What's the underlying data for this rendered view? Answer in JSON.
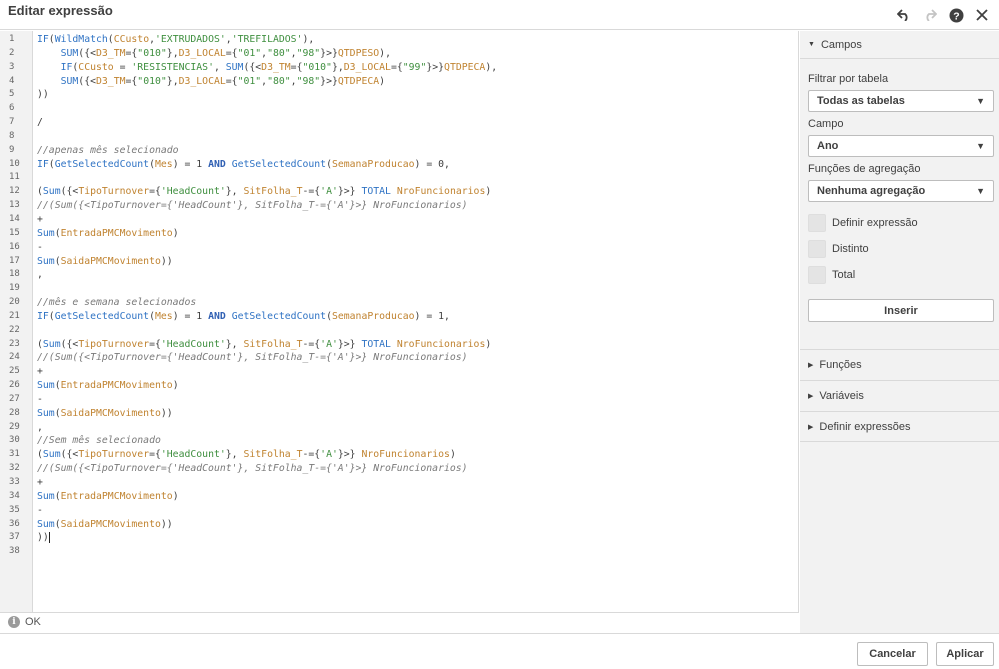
{
  "window": {
    "title": "Editar expressão",
    "icons": [
      "undo-icon",
      "redo-icon",
      "help-icon",
      "close-icon"
    ]
  },
  "editor": {
    "line_numbers": [
      "1",
      "2",
      "3",
      "4",
      "5",
      "6",
      "7",
      "8",
      "9",
      "10",
      "11",
      "12",
      "13",
      "14",
      "15",
      "16",
      "17",
      "18",
      "19",
      "20",
      "21",
      "22",
      "23",
      "24",
      "25",
      "26",
      "27",
      "28",
      "29",
      "30",
      "31",
      "32",
      "33",
      "34",
      "35",
      "36",
      "37",
      "38"
    ],
    "lines": [
      [
        [
          "fn",
          "IF"
        ],
        [
          "op",
          "("
        ],
        [
          "fn",
          "WildMatch"
        ],
        [
          "op",
          "("
        ],
        [
          "fld",
          "CCusto"
        ],
        [
          "op",
          ","
        ],
        [
          "str",
          "'EXTRUDADOS'"
        ],
        [
          "op",
          ","
        ],
        [
          "str",
          "'TREFILADOS'"
        ],
        [
          "op",
          "),"
        ]
      ],
      [
        [
          "op",
          "    "
        ],
        [
          "fn",
          "SUM"
        ],
        [
          "op",
          "({<"
        ],
        [
          "fld",
          "D3_TM"
        ],
        [
          "op",
          "={"
        ],
        [
          "str",
          "\"010\""
        ],
        [
          "op",
          "},"
        ],
        [
          "fld",
          "D3_LOCAL"
        ],
        [
          "op",
          "={"
        ],
        [
          "str",
          "\"01\""
        ],
        [
          "op",
          ","
        ],
        [
          "str",
          "\"80\""
        ],
        [
          "op",
          ","
        ],
        [
          "str",
          "\"98\""
        ],
        [
          "op",
          "}>}"
        ],
        [
          "fld",
          "QTDPESO"
        ],
        [
          "op",
          "),"
        ]
      ],
      [
        [
          "op",
          "    "
        ],
        [
          "fn",
          "IF"
        ],
        [
          "op",
          "("
        ],
        [
          "fld",
          "CCusto"
        ],
        [
          "op",
          " = "
        ],
        [
          "str",
          "'RESISTENCIAS'"
        ],
        [
          "op",
          ", "
        ],
        [
          "fn",
          "SUM"
        ],
        [
          "op",
          "({<"
        ],
        [
          "fld",
          "D3_TM"
        ],
        [
          "op",
          "={"
        ],
        [
          "str",
          "\"010\""
        ],
        [
          "op",
          "},"
        ],
        [
          "fld",
          "D3_LOCAL"
        ],
        [
          "op",
          "={"
        ],
        [
          "str",
          "\"99\""
        ],
        [
          "op",
          "}>}"
        ],
        [
          "fld",
          "QTDPECA"
        ],
        [
          "op",
          "),"
        ]
      ],
      [
        [
          "op",
          "    "
        ],
        [
          "fn",
          "SUM"
        ],
        [
          "op",
          "({<"
        ],
        [
          "fld",
          "D3_TM"
        ],
        [
          "op",
          "={"
        ],
        [
          "str",
          "\"010\""
        ],
        [
          "op",
          "},"
        ],
        [
          "fld",
          "D3_LOCAL"
        ],
        [
          "op",
          "={"
        ],
        [
          "str",
          "\"01\""
        ],
        [
          "op",
          ","
        ],
        [
          "str",
          "\"80\""
        ],
        [
          "op",
          ","
        ],
        [
          "str",
          "\"98\""
        ],
        [
          "op",
          "}>}"
        ],
        [
          "fld",
          "QTDPECA"
        ],
        [
          "op",
          ")"
        ]
      ],
      [
        [
          "op",
          "))"
        ]
      ],
      [],
      [
        [
          "op",
          "/"
        ]
      ],
      [],
      [
        [
          "com",
          "//apenas mês selecionado"
        ]
      ],
      [
        [
          "fn",
          "IF"
        ],
        [
          "op",
          "("
        ],
        [
          "fn",
          "GetSelectedCount"
        ],
        [
          "op",
          "("
        ],
        [
          "fld",
          "Mes"
        ],
        [
          "op",
          ") = 1 "
        ],
        [
          "kw",
          "AND"
        ],
        [
          "op",
          " "
        ],
        [
          "fn",
          "GetSelectedCount"
        ],
        [
          "op",
          "("
        ],
        [
          "fld",
          "SemanaProducao"
        ],
        [
          "op",
          ") = 0,"
        ]
      ],
      [],
      [
        [
          "op",
          "("
        ],
        [
          "fn",
          "Sum"
        ],
        [
          "op",
          "({<"
        ],
        [
          "fld",
          "TipoTurnover"
        ],
        [
          "op",
          "={"
        ],
        [
          "str",
          "'HeadCount'"
        ],
        [
          "op",
          "}, "
        ],
        [
          "fld",
          "SitFolha_T"
        ],
        [
          "op",
          "-={"
        ],
        [
          "str",
          "'A'"
        ],
        [
          "op",
          "}>} "
        ],
        [
          "fn",
          "TOTAL"
        ],
        [
          "op",
          " "
        ],
        [
          "fld",
          "NroFuncionarios"
        ],
        [
          "op",
          ")"
        ]
      ],
      [
        [
          "com",
          "//(Sum({<TipoTurnover={'HeadCount'}, SitFolha_T-={'A'}>} NroFuncionarios)"
        ]
      ],
      [
        [
          "op",
          "+"
        ]
      ],
      [
        [
          "fn",
          "Sum"
        ],
        [
          "op",
          "("
        ],
        [
          "fld",
          "EntradaPMCMovimento"
        ],
        [
          "op",
          ")"
        ]
      ],
      [
        [
          "op",
          "-"
        ]
      ],
      [
        [
          "fn",
          "Sum"
        ],
        [
          "op",
          "("
        ],
        [
          "fld",
          "SaidaPMCMovimento"
        ],
        [
          "op",
          "))"
        ]
      ],
      [
        [
          "op",
          ","
        ]
      ],
      [],
      [
        [
          "com",
          "//mês e semana selecionados"
        ]
      ],
      [
        [
          "fn",
          "IF"
        ],
        [
          "op",
          "("
        ],
        [
          "fn",
          "GetSelectedCount"
        ],
        [
          "op",
          "("
        ],
        [
          "fld",
          "Mes"
        ],
        [
          "op",
          ") = 1 "
        ],
        [
          "kw",
          "AND"
        ],
        [
          "op",
          " "
        ],
        [
          "fn",
          "GetSelectedCount"
        ],
        [
          "op",
          "("
        ],
        [
          "fld",
          "SemanaProducao"
        ],
        [
          "op",
          ") = 1,"
        ]
      ],
      [],
      [
        [
          "op",
          "("
        ],
        [
          "fn",
          "Sum"
        ],
        [
          "op",
          "({<"
        ],
        [
          "fld",
          "TipoTurnover"
        ],
        [
          "op",
          "={"
        ],
        [
          "str",
          "'HeadCount'"
        ],
        [
          "op",
          "}, "
        ],
        [
          "fld",
          "SitFolha_T"
        ],
        [
          "op",
          "-={"
        ],
        [
          "str",
          "'A'"
        ],
        [
          "op",
          "}>} "
        ],
        [
          "fn",
          "TOTAL"
        ],
        [
          "op",
          " "
        ],
        [
          "fld",
          "NroFuncionarios"
        ],
        [
          "op",
          ")"
        ]
      ],
      [
        [
          "com",
          "//(Sum({<TipoTurnover={'HeadCount'}, SitFolha_T-={'A'}>} NroFuncionarios)"
        ]
      ],
      [
        [
          "op",
          "+"
        ]
      ],
      [
        [
          "fn",
          "Sum"
        ],
        [
          "op",
          "("
        ],
        [
          "fld",
          "EntradaPMCMovimento"
        ],
        [
          "op",
          ")"
        ]
      ],
      [
        [
          "op",
          "-"
        ]
      ],
      [
        [
          "fn",
          "Sum"
        ],
        [
          "op",
          "("
        ],
        [
          "fld",
          "SaidaPMCMovimento"
        ],
        [
          "op",
          "))"
        ]
      ],
      [
        [
          "op",
          ","
        ]
      ],
      [
        [
          "com",
          "//Sem mês selecionado"
        ]
      ],
      [
        [
          "op",
          "("
        ],
        [
          "fn",
          "Sum"
        ],
        [
          "op",
          "({<"
        ],
        [
          "fld",
          "TipoTurnover"
        ],
        [
          "op",
          "={"
        ],
        [
          "str",
          "'HeadCount'"
        ],
        [
          "op",
          "}, "
        ],
        [
          "fld",
          "SitFolha_T"
        ],
        [
          "op",
          "-={"
        ],
        [
          "str",
          "'A'"
        ],
        [
          "op",
          "}>} "
        ],
        [
          "fld",
          "NroFuncionarios"
        ],
        [
          "op",
          ")"
        ]
      ],
      [
        [
          "com",
          "//(Sum({<TipoTurnover={'HeadCount'}, SitFolha_T-={'A'}>} NroFuncionarios)"
        ]
      ],
      [
        [
          "op",
          "+"
        ]
      ],
      [
        [
          "fn",
          "Sum"
        ],
        [
          "op",
          "("
        ],
        [
          "fld",
          "EntradaPMCMovimento"
        ],
        [
          "op",
          ")"
        ]
      ],
      [
        [
          "op",
          "-"
        ]
      ],
      [
        [
          "fn",
          "Sum"
        ],
        [
          "op",
          "("
        ],
        [
          "fld",
          "SaidaPMCMovimento"
        ],
        [
          "op",
          "))"
        ]
      ],
      [
        [
          "op",
          "))"
        ],
        [
          "cursor",
          ""
        ]
      ],
      []
    ]
  },
  "status": {
    "text": "OK"
  },
  "panel": {
    "campos_label": "Campos",
    "filter_label": "Filtrar por tabela",
    "filter_value": "Todas as tabelas",
    "field_label": "Campo",
    "field_value": "Ano",
    "agg_label": "Funções de agregação",
    "agg_value": "Nenhuma agregação",
    "checkboxes": [
      "Definir expressão",
      "Distinto",
      "Total"
    ],
    "insert_label": "Inserir",
    "sections": [
      "Funções",
      "Variáveis",
      "Definir expressões"
    ]
  },
  "footer": {
    "cancel_label": "Cancelar",
    "apply_label": "Aplicar"
  }
}
